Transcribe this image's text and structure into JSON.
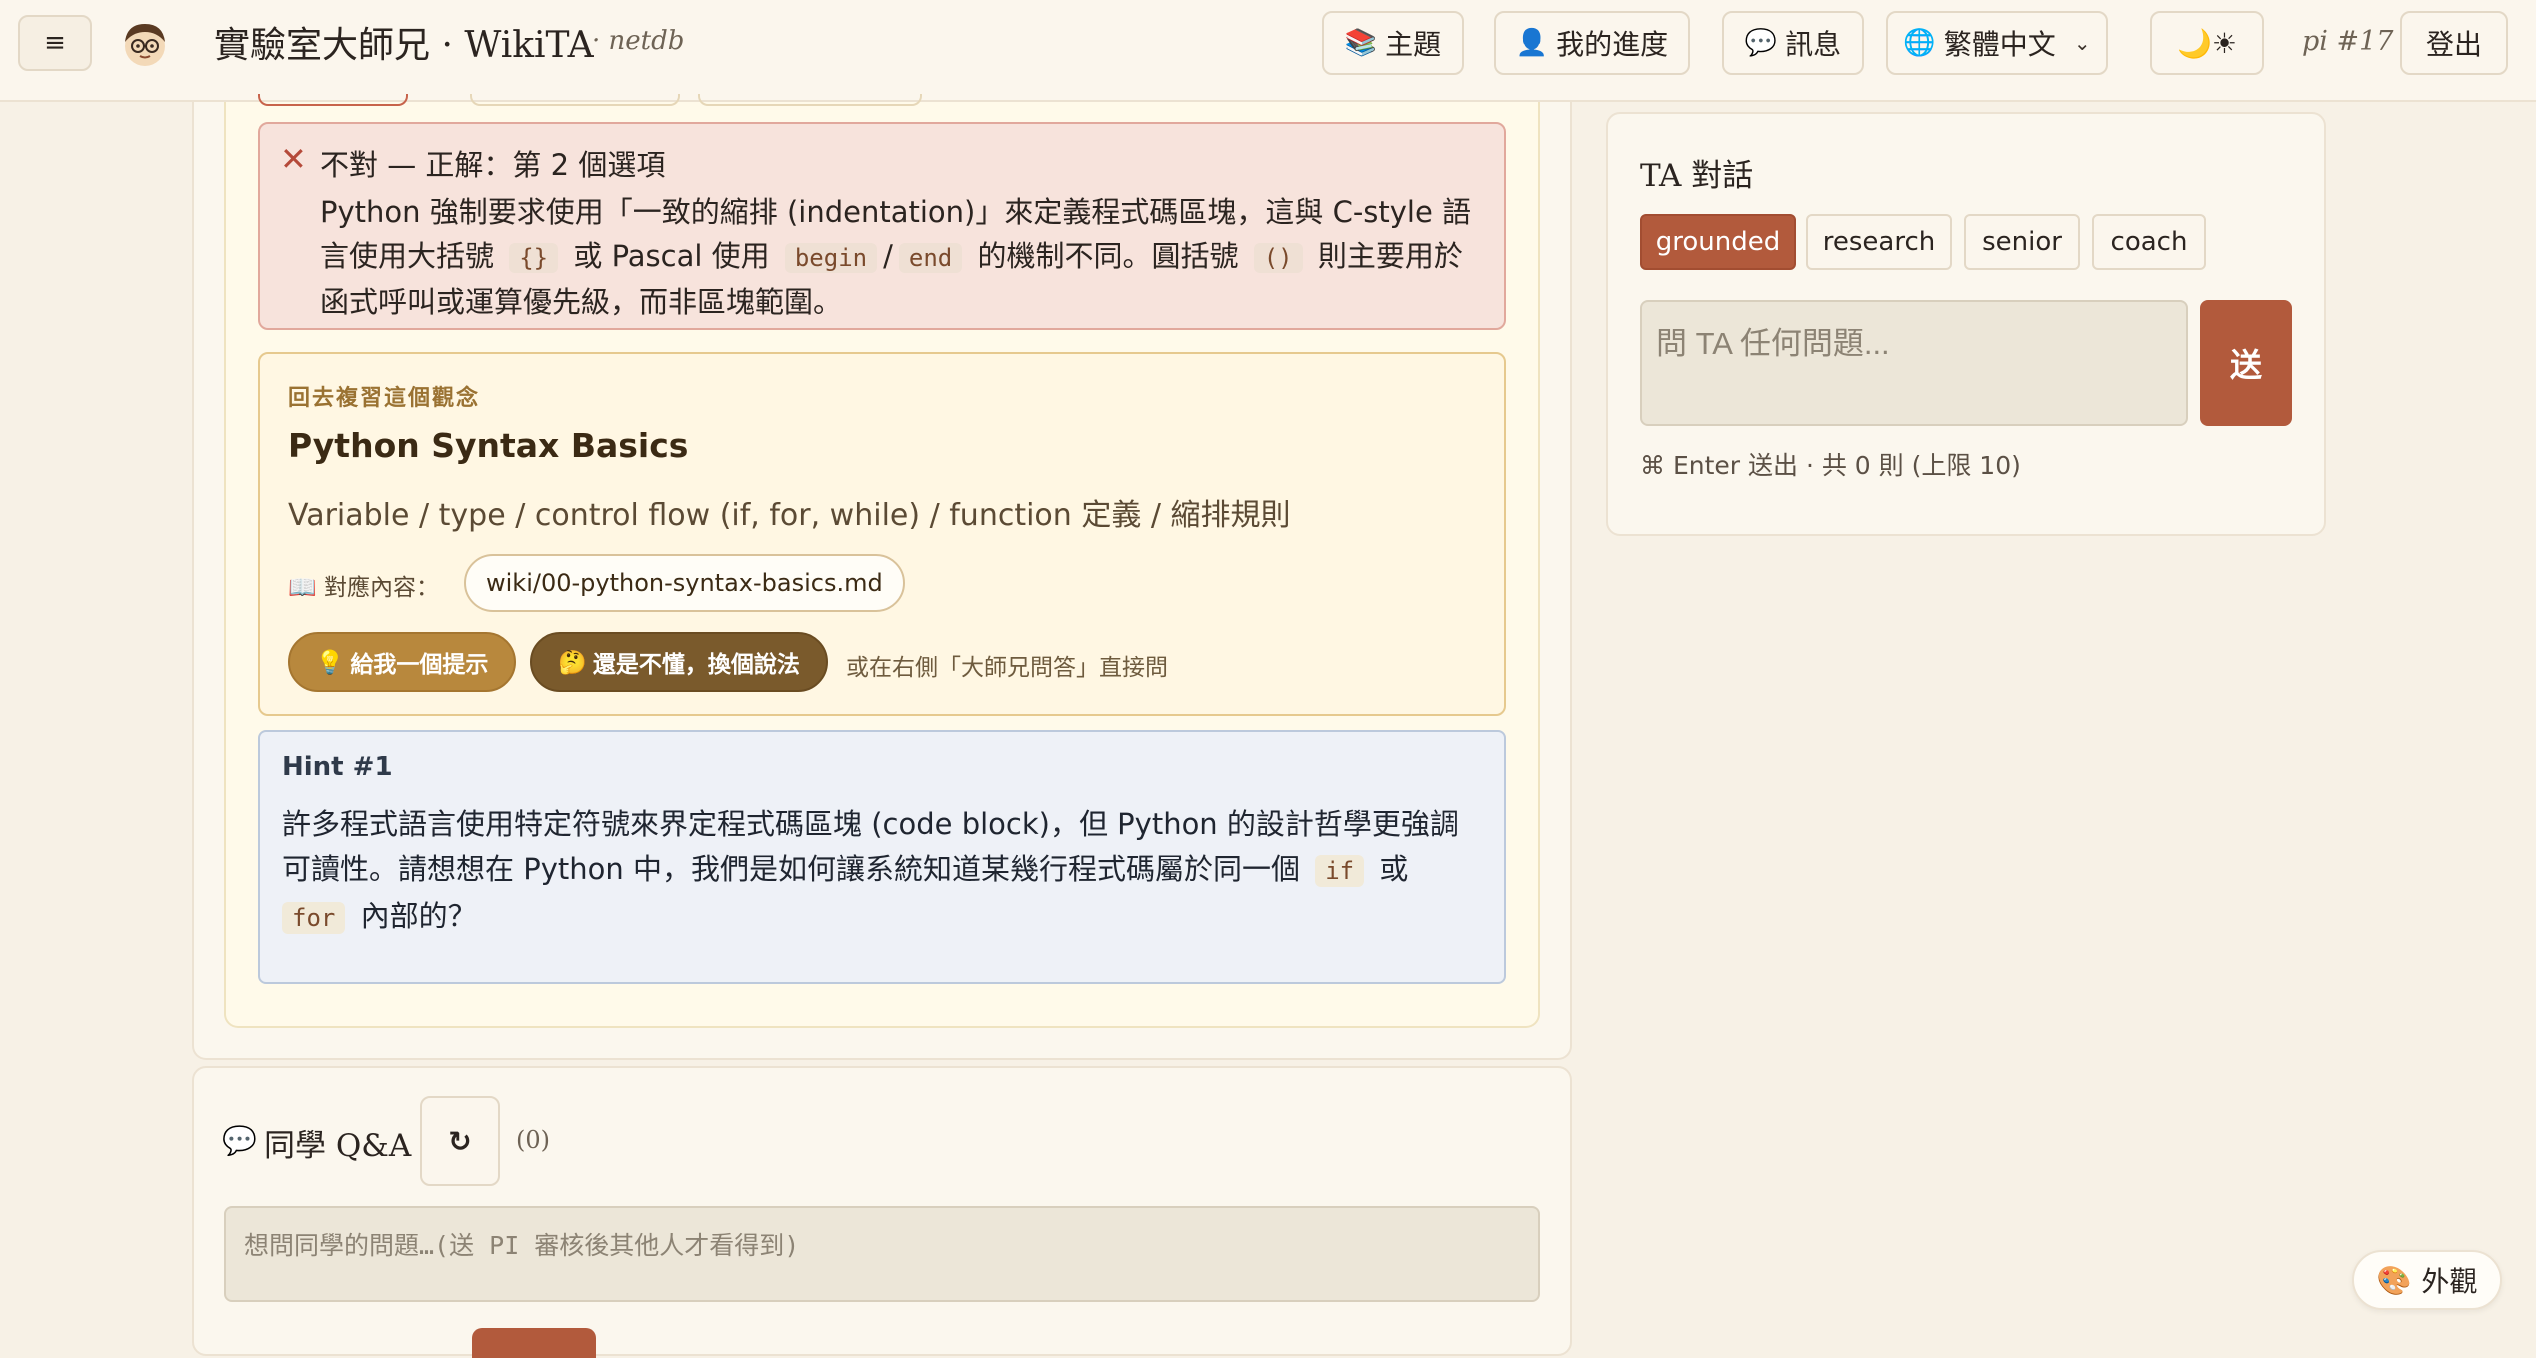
{
  "header": {
    "menu_icon": "hamburger-icon",
    "app_title": "實驗室大師兄 · WikiTA",
    "app_subtitle": "· netdb",
    "nav": {
      "topics": {
        "icon": "books-icon",
        "glyph": "📚",
        "label": "主題"
      },
      "progress": {
        "icon": "person-icon",
        "glyph": "👤",
        "label": "我的進度"
      },
      "messages": {
        "icon": "speech-bubble-icon",
        "glyph": "💬",
        "label": "訊息"
      },
      "language": {
        "icon": "globe-icon",
        "glyph": "🌐",
        "label": "繁體中文"
      },
      "theme_toggle": "🌙☀"
    },
    "user_tag": "pi #17",
    "logout_label": "登出"
  },
  "feedback": {
    "icon": "cross-icon",
    "mark": "✕",
    "heading": "不對 — 正解：第 2 個選項",
    "body_1": "Python 強制要求使用「一致的縮排 (indentation)」來定義程式碼區塊，這與 C-style 語言使用大括號",
    "code_braces": "{}",
    "body_2": "或 Pascal 使用",
    "code_begin": "begin",
    "slash": "/",
    "code_end": "end",
    "body_3": "的機制不同。圓括號",
    "code_parens": "()",
    "body_4": "則主要用於函式呼叫或運算優先級，而非區塊範圍。"
  },
  "review": {
    "kicker": "回去複習這個觀念",
    "title": "Python Syntax Basics",
    "description": "Variable / type / control flow (if, for, while) / function 定義 / 縮排規則",
    "map_icon": "📖",
    "map_label": "對應內容：",
    "wiki_link": "wiki/00-python-syntax-basics.md",
    "hint_button_icon": "💡",
    "hint_button": "給我一個提示",
    "rephrase_button_icon": "🤔",
    "rephrase_button": "還是不懂，換個說法",
    "alt_text": "或在右側「大師兄問答」直接問"
  },
  "hint": {
    "title": "Hint #1",
    "body_1": "許多程式語言使用特定符號來界定程式碼區塊 (code block)，但 Python 的設計哲學更強調可讀性。請想想在 Python 中，我們是如何讓系統知道某幾行程式碼屬於同一個",
    "code_if": "if",
    "body_2": "或",
    "code_for": "for",
    "body_3": "內部的？"
  },
  "qa": {
    "icon": "💬",
    "title": "同學 Q&A",
    "refresh": "↻",
    "count": "(0)",
    "placeholder": "想問同學的問題…(送 PI 審核後其他人才看得到)"
  },
  "ta_chat": {
    "title": "TA 對話",
    "modes": [
      "grounded",
      "research",
      "senior",
      "coach"
    ],
    "active_mode": "grounded",
    "placeholder": "問 TA 任何問題...",
    "send_label": "送",
    "hint_text": "⌘ Enter 送出 · 共 0 則 (上限 10)"
  },
  "appearance": {
    "icon": "🎨",
    "label": "外觀"
  },
  "colors": {
    "accent": "#b25a3c",
    "review_border": "#e6c98e",
    "error_bg": "#f7e3dc",
    "hint_bg": "#eef1f7"
  }
}
